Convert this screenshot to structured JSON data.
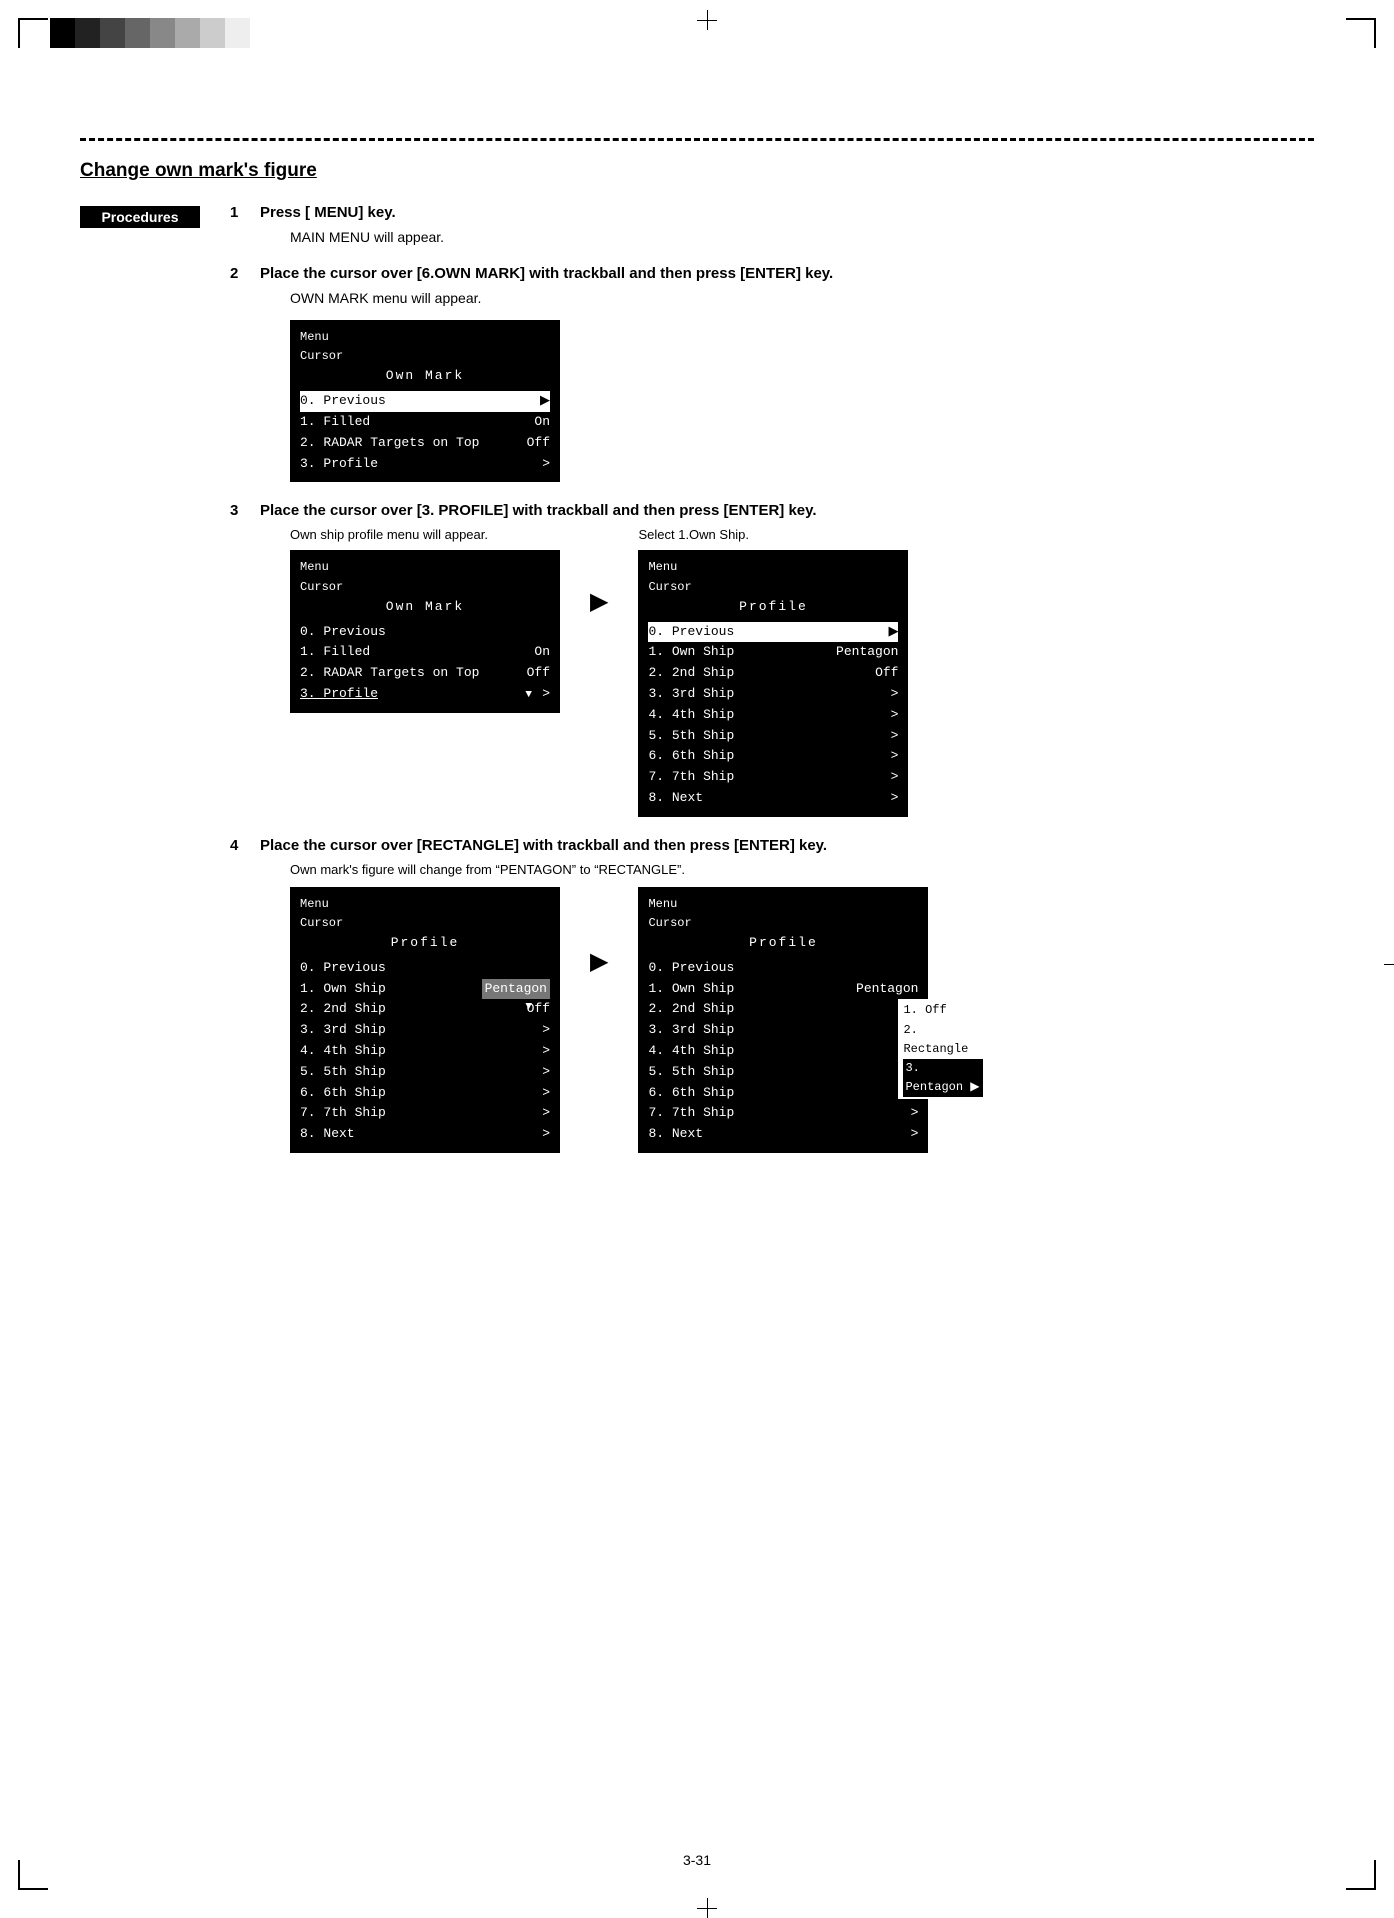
{
  "page": {
    "title": "Change own mark's figure",
    "procedures_label": "Procedures",
    "page_number": "3-31",
    "swatches": [
      "#000000",
      "#222222",
      "#444444",
      "#666666",
      "#888888",
      "#aaaaaa",
      "#cccccc",
      "#ffffff"
    ]
  },
  "steps": [
    {
      "num": "1",
      "text": "Press [ MENU] key.",
      "sub": "MAIN MENU will appear."
    },
    {
      "num": "2",
      "text": "Place the cursor over [6.OWN MARK] with trackball and then press [ENTER] key.",
      "sub": "OWN MARK menu will appear."
    },
    {
      "num": "3",
      "text": "Place the cursor over [3. PROFILE] with trackball and then press [ENTER] key.",
      "sub_left": "Own ship profile menu will appear.",
      "sub_right": "Select 1.Own Ship."
    },
    {
      "num": "4",
      "text": "Place the cursor over [RECTANGLE] with trackball and then press [ENTER] key.",
      "sub": "Own mark's figure will change from “PENTAGON” to “RECTANGLE”."
    }
  ],
  "screen1": {
    "label1": "Menu",
    "label2": "Cursor",
    "center": "Own Mark",
    "rows": [
      {
        "text": "0. Previous",
        "selected": true
      },
      {
        "text": "1. Filled",
        "value": "On"
      },
      {
        "text": "2. RADAR Targets on Top",
        "value": "Off"
      },
      {
        "text": "3. Profile",
        "value": ">"
      }
    ]
  },
  "screen2_left": {
    "label1": "Menu",
    "label2": "Cursor",
    "center": "Own Mark",
    "rows": [
      {
        "text": "0. Previous"
      },
      {
        "text": "1. Filled",
        "value": "On"
      },
      {
        "text": "2. RADAR Targets on Top",
        "value": "Off"
      },
      {
        "text": "3. Profile",
        "value": ">",
        "cursor": true
      }
    ]
  },
  "screen2_right": {
    "label1": "Menu",
    "label2": "Cursor",
    "center": "Profile",
    "rows": [
      {
        "text": "0. Previous",
        "selected": true
      },
      {
        "text": "1. Own Ship",
        "value": "Pentagon"
      },
      {
        "text": "2. 2nd Ship",
        "value": "Off"
      },
      {
        "text": "3. 3rd Ship",
        "value": ">"
      },
      {
        "text": "4. 4th Ship",
        "value": ">"
      },
      {
        "text": "5. 5th Ship",
        "value": ">"
      },
      {
        "text": "6. 6th Ship",
        "value": ">"
      },
      {
        "text": "7. 7th Ship",
        "value": ">"
      },
      {
        "text": "8. Next",
        "value": ">"
      }
    ]
  },
  "screen3_left": {
    "label1": "Menu",
    "label2": "Cursor",
    "center": "Profile",
    "rows": [
      {
        "text": "0. Previous"
      },
      {
        "text": "1. Own Ship",
        "value_highlight": "Pentagon"
      },
      {
        "text": "2. 2nd Ship",
        "value": "Off",
        "cursor": true
      },
      {
        "text": "3. 3rd Ship",
        "value": ">"
      },
      {
        "text": "4. 4th Ship",
        "value": ">"
      },
      {
        "text": "5. 5th Ship",
        "value": ">"
      },
      {
        "text": "6. 6th Ship",
        "value": ">"
      },
      {
        "text": "7. 7th Ship",
        "value": ">"
      },
      {
        "text": "8. Next",
        "value": ">"
      }
    ]
  },
  "screen3_right": {
    "label1": "Menu",
    "label2": "Cursor",
    "center": "Profile",
    "rows": [
      {
        "text": "0. Previous"
      },
      {
        "text": "1. Own Ship",
        "value": "Pentagon"
      },
      {
        "text": "2. 2nd Ship",
        "submenu": [
          "1. Off",
          "2. Rectangle",
          "3. Pentagon"
        ],
        "sub3highlight": true
      },
      {
        "text": "3. 3rd Ship",
        "value": ">"
      },
      {
        "text": "4. 4th Ship",
        "value": ">"
      },
      {
        "text": "5. 5th Ship",
        "value": ">"
      },
      {
        "text": "6. 6th Ship",
        "value": ">"
      },
      {
        "text": "7. 7th Ship",
        "value": ">"
      },
      {
        "text": "8. Next",
        "value": ">"
      }
    ]
  }
}
